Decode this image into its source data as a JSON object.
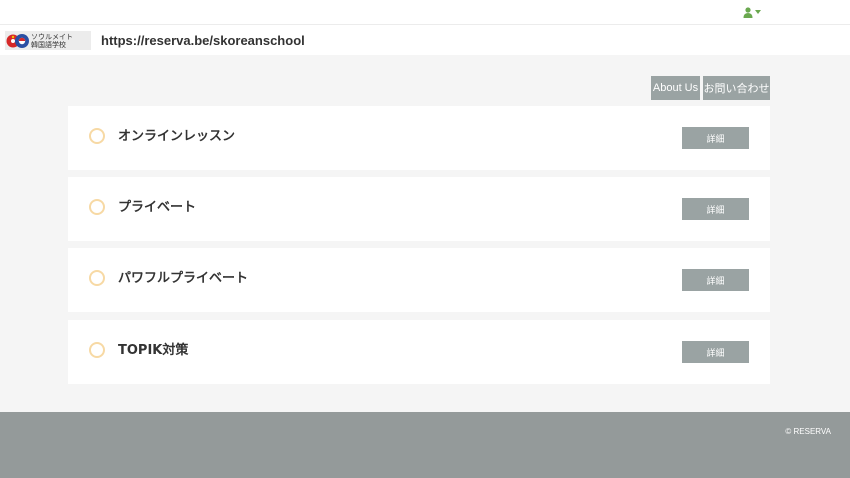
{
  "topbar": {
    "user_icon": "user-icon",
    "caret_icon": "chevron-down-icon",
    "accent": "#6aa84f"
  },
  "header": {
    "logo_line1": "ソウルメイト",
    "logo_line2": "韓国語学校",
    "url": "https://reserva.be/skoreanschool"
  },
  "nav": {
    "about_label": "About Us",
    "contact_label": "お問い合わせ"
  },
  "menus": [
    {
      "title": "オンラインレッスン",
      "button": "詳細"
    },
    {
      "title": "プライベート",
      "button": "詳細"
    },
    {
      "title": "パワフルプライベート",
      "button": "詳細"
    },
    {
      "title": "TOPIK対策",
      "button": "詳細"
    }
  ],
  "footer": {
    "copyright": "© RESERVA"
  },
  "colors": {
    "button_gray": "#9aa3a3",
    "footer_gray": "#949a9a",
    "radio_border": "#f7d9a4",
    "background": "#f5f5f5"
  }
}
